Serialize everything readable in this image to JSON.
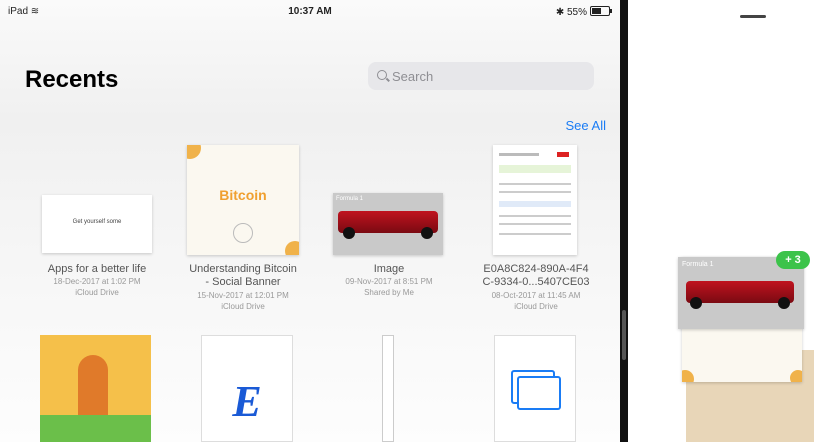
{
  "status_bar": {
    "device": "iPad",
    "time": "10:37 AM",
    "battery": "55%"
  },
  "page": {
    "title": "Recents",
    "see_all": "See All"
  },
  "search": {
    "placeholder": "Search"
  },
  "files": [
    {
      "name_lines": [
        "Apps for a better life"
      ],
      "date": "18-Dec-2017 at 1:02 PM",
      "location": "iCloud Drive",
      "thumb_text": "Get yourself some"
    },
    {
      "name_lines": [
        "Understanding Bitcoin",
        "- Social Banner"
      ],
      "date": "15-Nov-2017 at 12:01 PM",
      "location": "iCloud Drive",
      "thumb_text": "Bitcoin"
    },
    {
      "name_lines": [
        "Image"
      ],
      "date": "09-Nov-2017 at 8:51 PM",
      "location": "Shared by Me",
      "thumb_text": "Formula 1"
    },
    {
      "name_lines": [
        "E0A8C824-890A-4F4",
        "C-9334-0...5407CE03"
      ],
      "date": "08-Oct-2017 at 11:45 AM",
      "location": "iCloud Drive",
      "thumb_text": ""
    }
  ],
  "bottom_icons": [
    "E"
  ],
  "drag_stack": {
    "count_badge": "+ 3",
    "thumb_text": "Formula 1"
  },
  "colors": {
    "accent": "#1a7cf5",
    "badge": "#3cc34a"
  }
}
